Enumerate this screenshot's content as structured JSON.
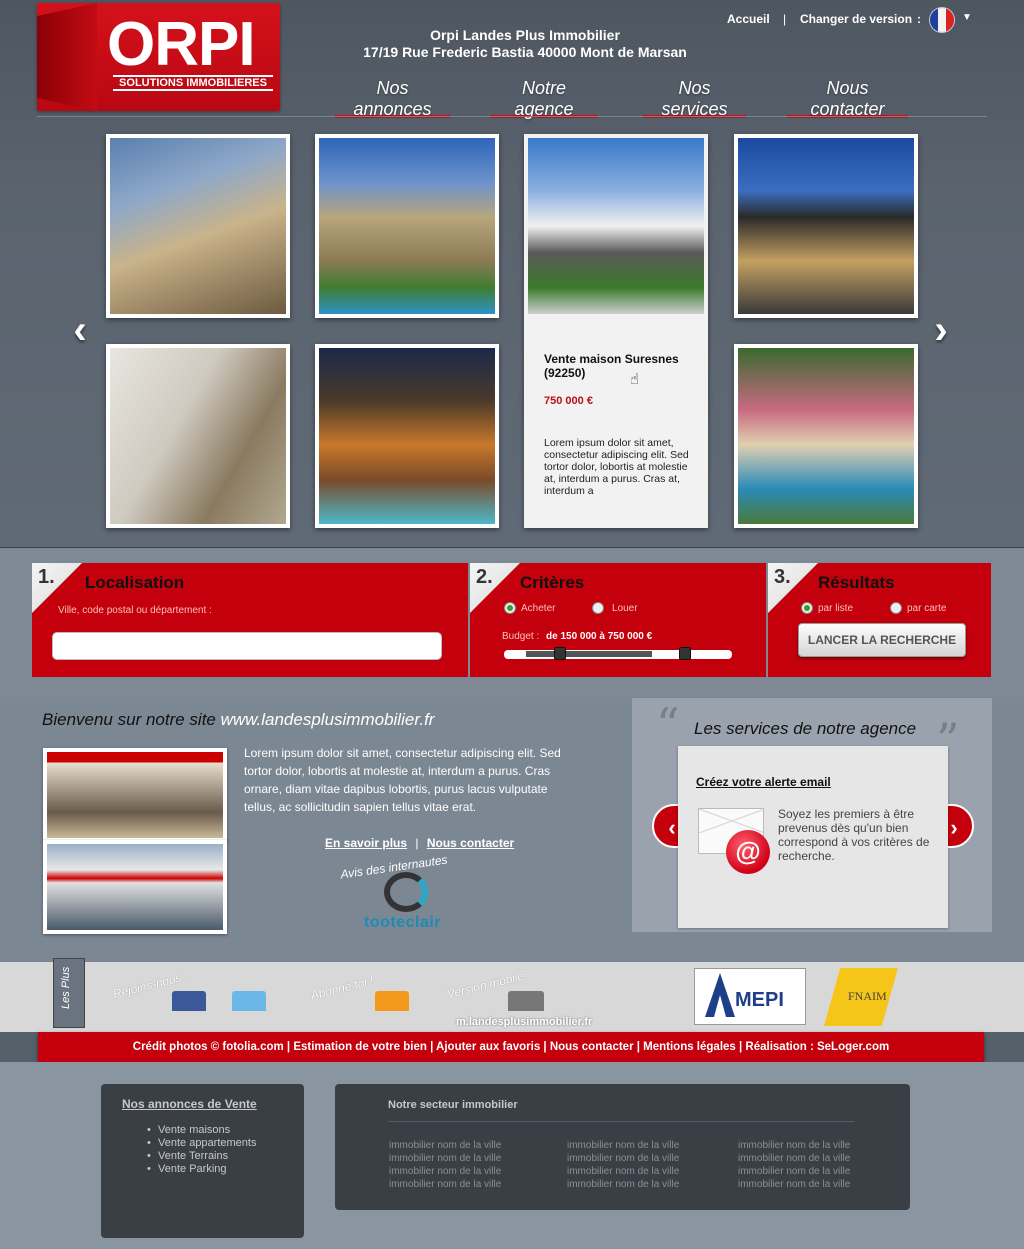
{
  "header": {
    "logo_word": "ORPI",
    "logo_tagline": "SOLUTIONS IMMOBILIERES",
    "agency_name": "Orpi Landes Plus Immobilier",
    "agency_address": "17/19 Rue Frederic Bastia 40000 Mont de Marsan",
    "home_link": "Accueil",
    "separator": "|",
    "version_label": "Changer de version",
    "version_colon": ":"
  },
  "nav": {
    "items": [
      "Nos annonces",
      "Notre agence",
      "Nos services",
      "Nous contacter"
    ]
  },
  "carousel": {
    "prev": "‹",
    "next": "›",
    "featured": {
      "title": "Vente maison Suresnes (92250)",
      "price": "750 000 €",
      "description": "Lorem ipsum dolor sit amet, consectetur adipiscing elit. Sed tortor dolor, lobortis at molestie at, interdum a purus. Cras at, interdum a"
    }
  },
  "search": {
    "step1": {
      "num": "1.",
      "title": "Localisation",
      "label": "Ville, code postal ou département :",
      "input_value": ""
    },
    "step2": {
      "num": "2.",
      "title": "Critères",
      "option_buy": "Acheter",
      "option_rent": "Louer",
      "budget_label": "Budget :",
      "budget_value": "de 150 000 à 750 000 €",
      "budget_min": 150000,
      "budget_max": 750000
    },
    "step3": {
      "num": "3.",
      "title": "Résultats",
      "option_list": "par liste",
      "option_map": "par carte",
      "button": "LANCER LA RECHERCHE"
    }
  },
  "welcome": {
    "title": "Bienvenu sur notre site",
    "site": "www.landesplusimmobilier.fr",
    "text": "Lorem ipsum dolor sit amet, consectetur adipiscing elit. Sed tortor dolor, lobortis at molestie at, interdum a purus. Cras ornare, diam vitae dapibus lobortis, purus lacus vulputate tellus, ac sollicitudin sapien tellus vitae erat.",
    "link_more": "En savoir plus",
    "link_sep": "|",
    "link_contact": "Nous contacter",
    "reviews_label": "Avis des internautes",
    "reviews_brand": "tooteclair"
  },
  "services": {
    "title": "Les services de notre agence",
    "alert_title": "Créez votre alerte email",
    "alert_text": "Soyez les premiers à être prevenus dès qu'un bien correspond à vos critères de recherche.",
    "prev": "‹",
    "next": "›"
  },
  "les_plus": {
    "tab_label": "Les Plus",
    "join_note": "Rejoins-nous !",
    "subscribe_note": "Abonne toi !",
    "mobile_note": "Version mobile",
    "mobile_url": "m.landesplusimmobilier.fr",
    "amepi": "MEPI",
    "fnaim": "FNAIM"
  },
  "footer": {
    "links": "Crédit photos © fotolia.com | Estimation de votre bien | Ajouter aux favoris | Nous contacter | Mentions légales | Réalisation : SeLoger.com",
    "sale_title": "Nos annonces de Vente",
    "sale_items": [
      "Vente maisons",
      "Vente appartements",
      "Vente Terrains",
      "Vente Parking"
    ],
    "sector_title": "Notre secteur immobilier",
    "sector_city": "immobilier nom de la ville"
  },
  "colors": {
    "brand_red": "#c3000c",
    "price_red": "#b8101a"
  }
}
